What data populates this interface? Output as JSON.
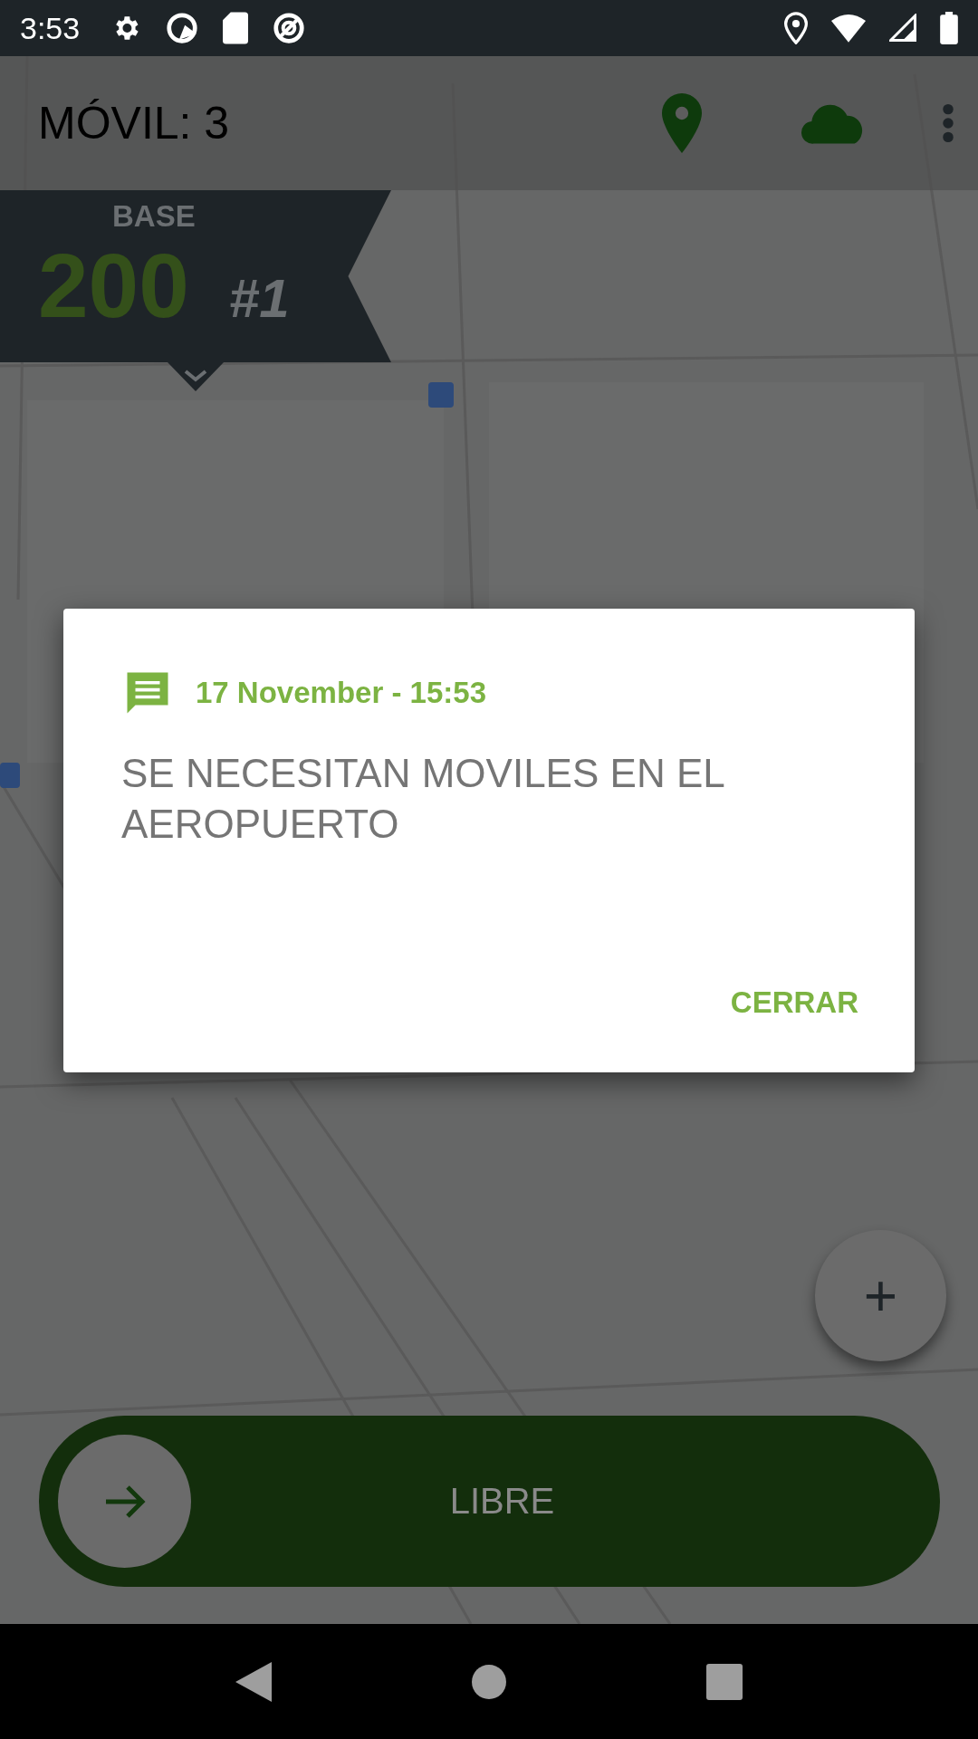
{
  "status_bar": {
    "time": "3:53"
  },
  "app_bar": {
    "title": "MÓVIL: 3"
  },
  "base_banner": {
    "label": "BASE",
    "number": "200",
    "rank": "#1"
  },
  "zoom_button": {
    "label": "+"
  },
  "slide_control": {
    "label": "LIBRE"
  },
  "dialog": {
    "date": "17 November - 15:53",
    "message": "SE NECESITAN MOVILES EN EL AEROPUERTO",
    "button": "CERRAR"
  }
}
